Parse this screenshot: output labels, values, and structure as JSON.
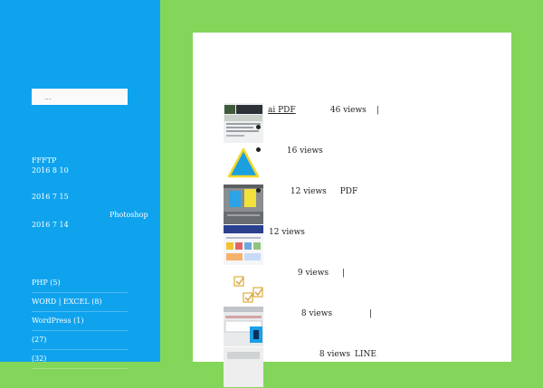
{
  "search": {
    "placeholder": "..."
  },
  "recent_posts": [
    {
      "title": "FFFTP",
      "date": "2016  8  10"
    },
    {
      "title": "",
      "date": "2016  7  15"
    },
    {
      "title": "Photoshop",
      "date": "2016  7  14"
    }
  ],
  "categories": [
    {
      "label": "PHP (5)"
    },
    {
      "label": "WORD | EXCEL (8)"
    },
    {
      "label": "WordPress (1)"
    },
    {
      "label": " (27)"
    },
    {
      "label": " (32)"
    }
  ],
  "popular": [
    {
      "title": "ai  PDF",
      "views": "46 views",
      "extra": "|"
    },
    {
      "title": "",
      "views": "16 views",
      "extra": ""
    },
    {
      "title": "",
      "views": "12 views",
      "extra": "PDF"
    },
    {
      "title": "",
      "views": "12 views",
      "extra": ""
    },
    {
      "title": "",
      "views": "9 views",
      "extra": "|"
    },
    {
      "title": "",
      "views": "8 views",
      "extra": "|"
    },
    {
      "title": "",
      "views": "8 views",
      "extra": "LINE"
    }
  ],
  "colors": {
    "sidebar_bg": "#0fa3ee",
    "page_bg": "#83d65a",
    "content_bg": "#ffffff"
  }
}
